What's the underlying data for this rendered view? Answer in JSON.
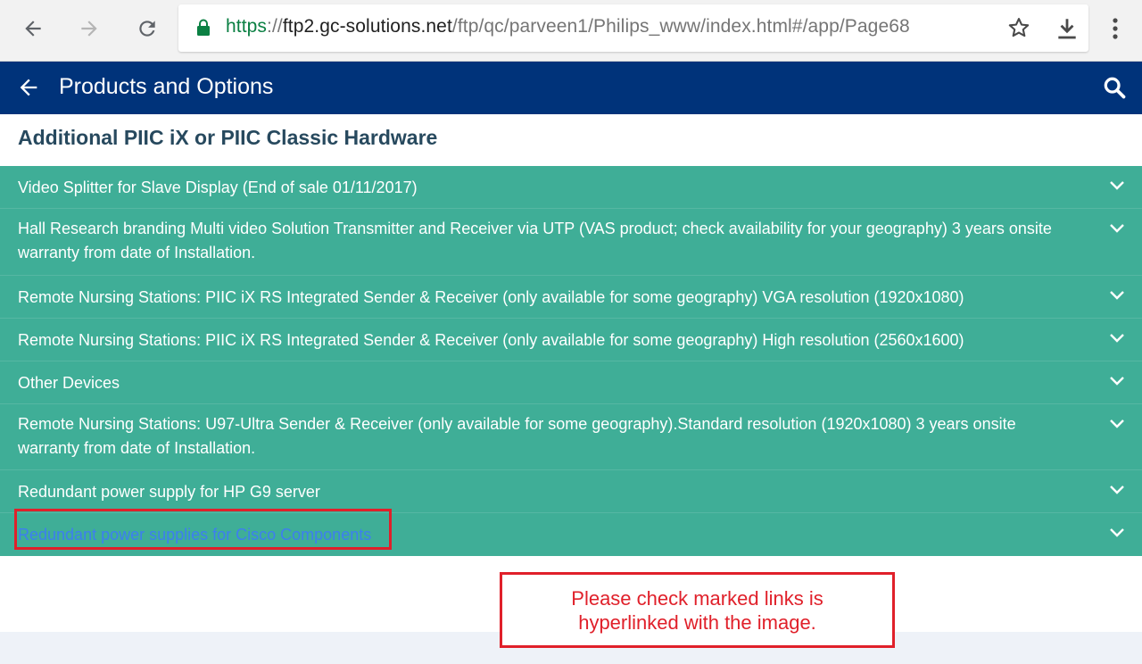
{
  "browser": {
    "url_scheme": "https",
    "url_sep": "://",
    "url_host": "ftp2.gc-solutions.net",
    "url_path": "/ftp/qc/parveen1/Philips_www/index.html#/app/Page68"
  },
  "header": {
    "title": "Products and Options",
    "background": "#00337a"
  },
  "section": {
    "heading": "Additional PIIC iX or PIIC Classic Hardware"
  },
  "accordion": {
    "background": "#3fae97",
    "items": [
      {
        "label": "Video Splitter for Slave Display (End of sale 01/11/2017)"
      },
      {
        "label": "Hall Research branding Multi video Solution Transmitter and Receiver via UTP (VAS product; check availability for your geography) 3 years onsite warranty from date of Installation."
      },
      {
        "label": "Remote Nursing Stations: PIIC iX RS Integrated Sender & Receiver (only available for some geography) VGA resolution (1920x1080)"
      },
      {
        "label": "Remote Nursing Stations: PIIC iX RS Integrated Sender & Receiver (only available for some geography) High resolution (2560x1600)"
      },
      {
        "label": "Other Devices"
      },
      {
        "label": "Remote Nursing Stations: U97-Ultra Sender & Receiver (only available for some geography).Standard resolution (1920x1080) 3 years onsite warranty from date of Installation."
      },
      {
        "label": "Redundant power supply for HP G9 server"
      },
      {
        "label": "Redundant power supplies for Cisco Components"
      }
    ]
  },
  "annotation": {
    "note": "Please check marked links is hyperlinked with the image.",
    "color": "#e0202a"
  }
}
